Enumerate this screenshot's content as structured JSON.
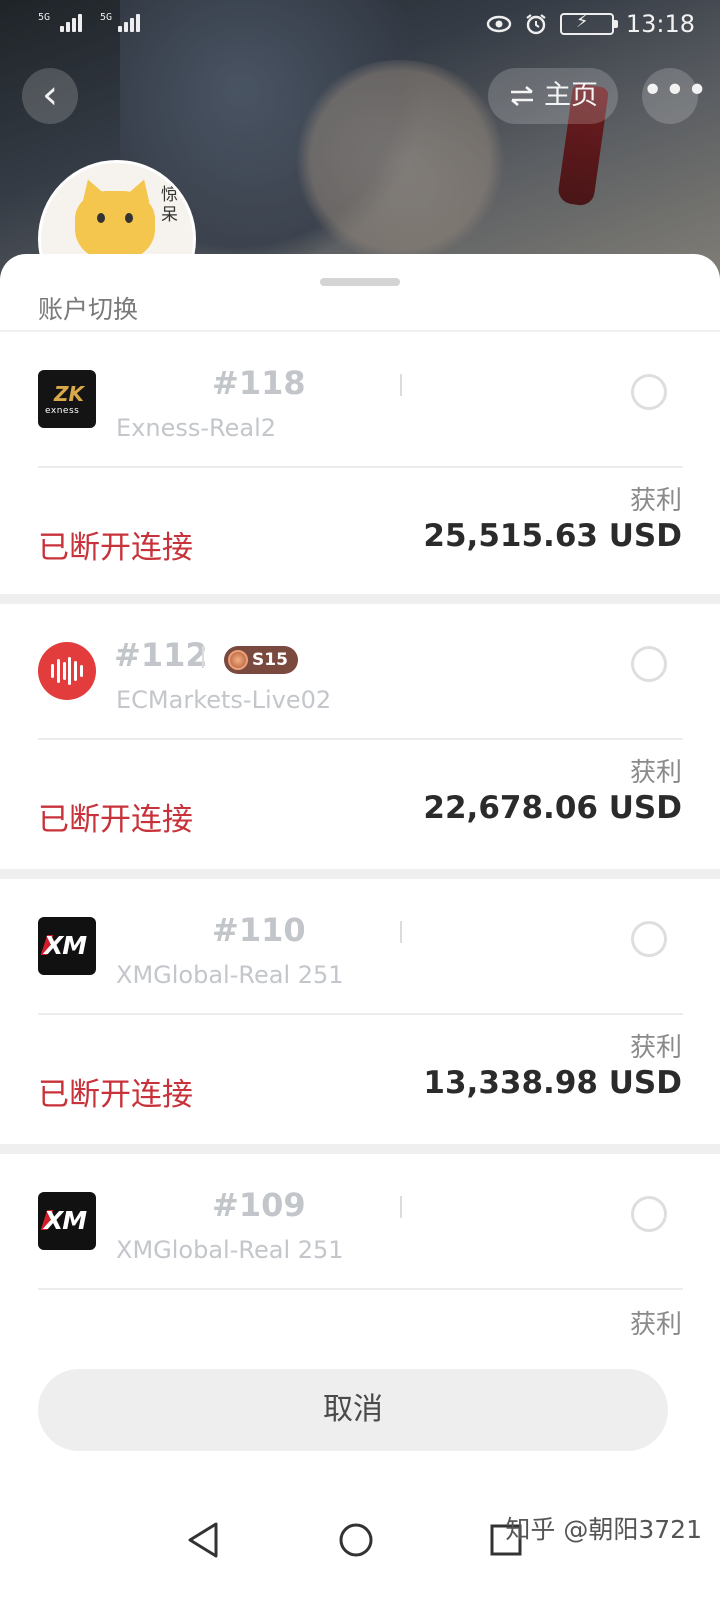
{
  "status_bar": {
    "signal1_label": "5G",
    "signal2_label": "5G",
    "time": "13:18",
    "icons": [
      "eye-icon",
      "alarm-icon",
      "battery-charging-icon"
    ]
  },
  "header": {
    "back_icon": "chevron-left-icon",
    "home_label": "主页",
    "home_icon": "swap-icon",
    "more_icon": "more-dots-icon",
    "avatar_text": "惊呆"
  },
  "sheet": {
    "title": "账户切换",
    "accounts": [
      {
        "number": "#118",
        "server": "Exness-Real2",
        "logo": "exness-logo",
        "badge": "",
        "status": "已断开连接",
        "profit_label": "获利",
        "profit_value": "25,515.63 USD"
      },
      {
        "number": "#112",
        "server": "ECMarkets-Live02",
        "logo": "ecmarkets-logo",
        "badge": "S15",
        "status": "已断开连接",
        "profit_label": "获利",
        "profit_value": "22,678.06 USD"
      },
      {
        "number": "#110",
        "server": "XMGlobal-Real 251",
        "logo": "xm-logo",
        "badge": "",
        "status": "已断开连接",
        "profit_label": "获利",
        "profit_value": "13,338.98 USD"
      },
      {
        "number": "#109",
        "server": "XMGlobal-Real 251",
        "logo": "xm-logo",
        "badge": "",
        "status": "",
        "profit_label": "获利",
        "profit_value": ""
      }
    ],
    "cancel_label": "取消"
  },
  "logos": {
    "exness_mark": "ZK",
    "exness_word": "exness",
    "xm_text": "XM"
  },
  "system_nav": {
    "back_icon": "triangle-back-icon",
    "home_icon": "circle-home-icon",
    "recents_icon": "square-recents-icon"
  },
  "watermark": "知乎 @朝阳3721",
  "colors": {
    "disconnected": "#c8323a",
    "profit_value": "#2b2b2b",
    "account_number": "#c2c5c9"
  }
}
